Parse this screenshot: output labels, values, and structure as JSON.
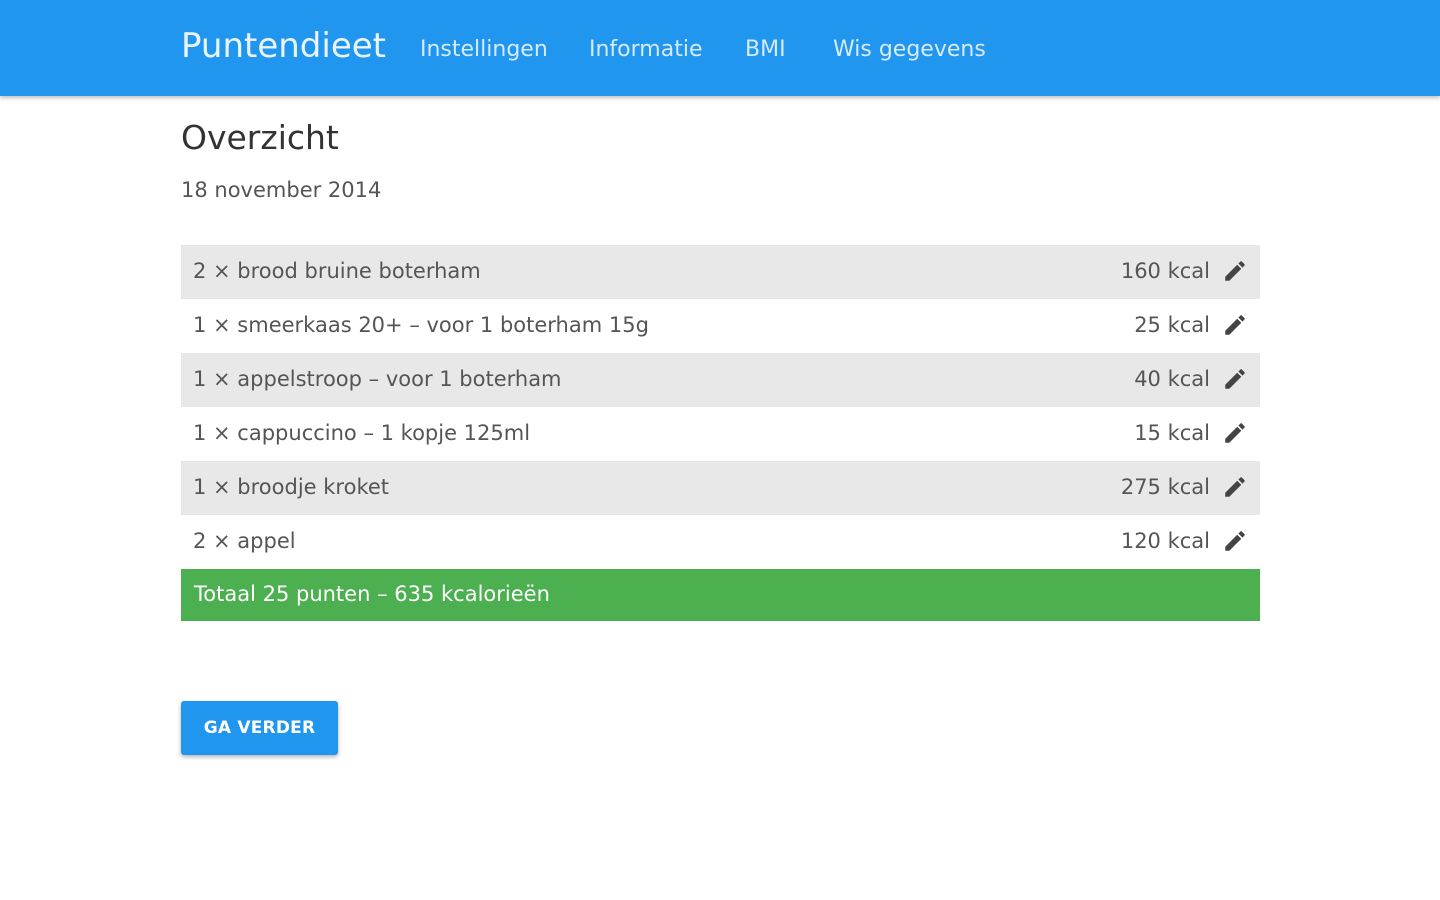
{
  "header": {
    "brand": "Puntendieet",
    "nav": [
      {
        "label": "Instellingen"
      },
      {
        "label": "Informatie"
      },
      {
        "label": "BMI"
      },
      {
        "label": "Wis gegevens"
      }
    ]
  },
  "main": {
    "title": "Overzicht",
    "date": "18 november 2014",
    "items": [
      {
        "label": "2 × brood bruine boterham",
        "kcal": "160 kcal",
        "icon": "pencil-icon"
      },
      {
        "label": "1 × smeerkaas 20+ – voor 1 boterham 15g",
        "kcal": "25 kcal",
        "icon": "pencil-icon"
      },
      {
        "label": "1 × appelstroop – voor 1 boterham",
        "kcal": "40 kcal",
        "icon": "pencil-icon"
      },
      {
        "label": "1 × cappuccino – 1 kopje 125ml",
        "kcal": "15 kcal",
        "icon": "pencil-icon"
      },
      {
        "label": "1 × broodje kroket",
        "kcal": "275 kcal",
        "icon": "pencil-icon"
      },
      {
        "label": "2 × appel",
        "kcal": "120 kcal",
        "icon": "pencil-icon"
      }
    ],
    "total": "Totaal  25 punten – 635 kcalorieën",
    "continue_label": "GA VERDER"
  },
  "colors": {
    "header": "#2196ee",
    "total": "#4caf50",
    "row_alt": "#e8e8e8",
    "button": "#2196ee"
  }
}
